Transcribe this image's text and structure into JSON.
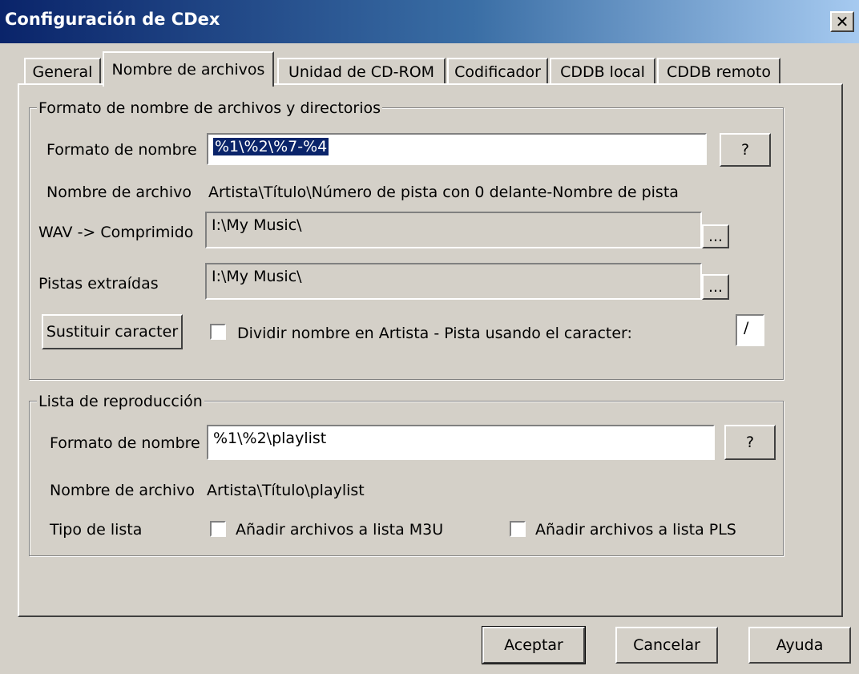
{
  "window": {
    "title": "Configuración de CDex",
    "close_label": "✕"
  },
  "tabs": [
    {
      "label": "General"
    },
    {
      "label": "Nombre de archivos"
    },
    {
      "label": "Unidad de CD-ROM"
    },
    {
      "label": "Codificador"
    },
    {
      "label": "CDDB local"
    },
    {
      "label": "CDDB remoto"
    }
  ],
  "active_tab": "Nombre de archivos",
  "file_format_group": {
    "legend": "Formato de nombre de archivos y directorios",
    "name_format_label": "Formato de nombre",
    "name_format_value": "%1\\%2\\%7-%4",
    "name_help_label": "?",
    "file_name_label": "Nombre de archivo",
    "file_name_preview": "Artista\\Título\\Número de pista con 0 delante-Nombre de pista",
    "wav_label": "WAV -> Comprimido",
    "wav_path": "I:\\My Music\\",
    "wav_browse_label": "...",
    "ripped_label": "Pistas extraídas",
    "ripped_path": "I:\\My Music\\",
    "ripped_browse_label": "...",
    "replace_char_button": "Sustituir caracter",
    "split_checkbox_label": "Dividir nombre en Artista - Pista usando el caracter:",
    "split_checked": false,
    "split_char": "/"
  },
  "playlist_group": {
    "legend": "Lista de reproducción",
    "name_format_label": "Formato de nombre",
    "name_format_value": "%1\\%2\\playlist",
    "help_label": "?",
    "file_name_label": "Nombre de archivo",
    "file_name_preview": "Artista\\Título\\playlist",
    "list_type_label": "Tipo de lista",
    "m3u_label": "Añadir archivos a lista M3U",
    "m3u_checked": false,
    "pls_label": "Añadir archivos a lista PLS",
    "pls_checked": false
  },
  "footer": {
    "accept": "Aceptar",
    "cancel": "Cancelar",
    "help": "Ayuda"
  }
}
